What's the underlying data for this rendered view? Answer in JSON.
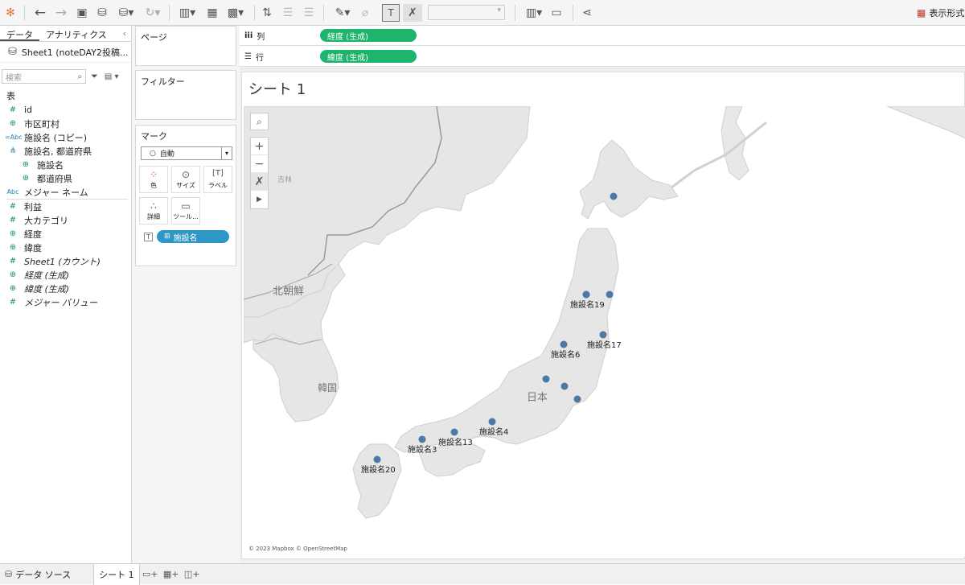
{
  "toolbar": {
    "show_me_label": "表示形式"
  },
  "left_pane": {
    "tabs": [
      "データ",
      "アナリティクス"
    ],
    "data_source": "Sheet1 (noteDAY2投稿...",
    "search_placeholder": "検索",
    "section_label": "表",
    "fields": [
      {
        "icon": "#",
        "name": "id"
      },
      {
        "icon": "⊕",
        "name": "市区町村"
      },
      {
        "icon": "=Abc",
        "name": "施設名 (コピー)"
      },
      {
        "icon": "⋔",
        "name": "施設名, 都道府県"
      },
      {
        "icon": "⊕",
        "name": "施設名"
      },
      {
        "icon": "⊕",
        "name": "都道府県"
      },
      {
        "icon": "Abc",
        "name": "メジャー ネーム"
      },
      {
        "icon": "#",
        "name": "利益"
      },
      {
        "icon": "#",
        "name": "大カテゴリ"
      },
      {
        "icon": "⊕",
        "name": "経度"
      },
      {
        "icon": "⊕",
        "name": "緯度"
      },
      {
        "icon": "#",
        "name": "Sheet1 (カウント)"
      },
      {
        "icon": "⊕",
        "name": "経度 (生成)"
      },
      {
        "icon": "⊕",
        "name": "緯度 (生成)"
      },
      {
        "icon": "#",
        "name": "メジャー バリュー"
      }
    ]
  },
  "cards": {
    "pages_title": "ページ",
    "filters_title": "フィルター",
    "marks_title": "マーク",
    "mark_type": "自動",
    "mark_buttons": [
      "色",
      "サイズ",
      "ラベル",
      "詳細",
      "ツール..."
    ],
    "mark_pill": "施設名"
  },
  "shelves": {
    "columns_label": "列",
    "columns_pill": "経度 (生成)",
    "rows_label": "行",
    "rows_pill": "緯度 (生成)"
  },
  "view": {
    "title": "シート 1",
    "attribution": "© 2023 Mapbox © OpenStreetMap",
    "map_labels": {
      "jilin": "吉林",
      "north_korea": "北朝鮮",
      "korea": "韓国",
      "japan": "日本"
    }
  },
  "points": [
    {
      "label": ""
    },
    {
      "label": ""
    },
    {
      "label": "施設名19"
    },
    {
      "label": ""
    },
    {
      "label": "施設名17"
    },
    {
      "label": "施設名6"
    },
    {
      "label": ""
    },
    {
      "label": ""
    },
    {
      "label": ""
    },
    {
      "label": "施設名4"
    },
    {
      "label": "施設名13"
    },
    {
      "label": "施設名3"
    },
    {
      "label": "施設名20"
    }
  ],
  "colors": {
    "pill_green": "#1db46c",
    "pill_blue": "#2e97c6",
    "point": "#4e79a7"
  },
  "bottom_bar": {
    "data_source_tab": "データ ソース",
    "sheet_tab": "シート 1"
  }
}
